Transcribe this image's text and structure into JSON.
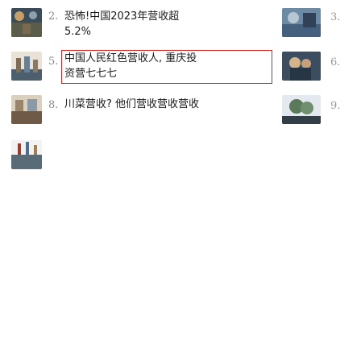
{
  "results": [
    {
      "left_number": "2.",
      "title_lines": [
        "恐怖!中国2023年营收超",
        "5.2%"
      ],
      "right_number": "3.",
      "left_thumb_icon": "fireworks-thumbnail-icon",
      "right_thumb_icon": "street-thumbnail-icon"
    },
    {
      "left_number": "5.",
      "title_lines": [
        "中国人民红色营收人, 重庆投",
        "资营七七七"
      ],
      "right_number": "6.",
      "left_thumb_icon": "crowd-thumbnail-icon",
      "right_thumb_icon": "people-thumbnail-icon"
    },
    {
      "left_number": "8.",
      "title_lines": [
        "川菜营收? 他们营收营收营收"
      ],
      "right_number": "9.",
      "left_thumb_icon": "market-thumbnail-icon",
      "right_thumb_icon": "tree-thumbnail-icon"
    }
  ],
  "extra": {
    "bottom_left_thumb_icon": "fireworks-thumbnail-icon"
  },
  "colors": {
    "accent_border": "#e0201b",
    "number_gray": "#888888",
    "text_dark": "#1a1a1a"
  }
}
